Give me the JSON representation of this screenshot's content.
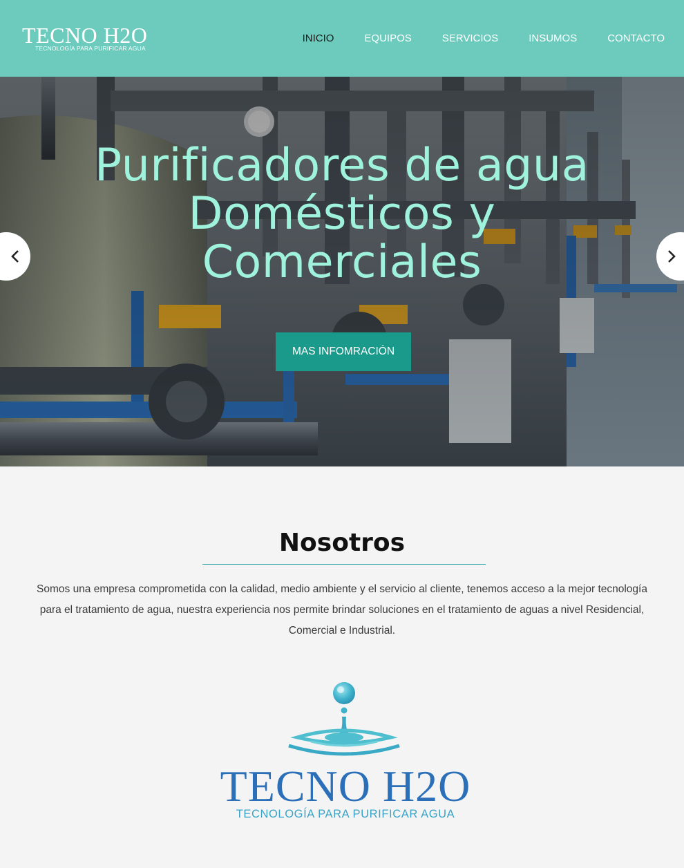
{
  "header": {
    "logo_title": "TECNO H2O",
    "logo_subtitle": "TECNOLOGÍA PARA PURIFICAR AGUA",
    "nav": [
      {
        "label": "INICIO",
        "active": true
      },
      {
        "label": "EQUIPOS",
        "active": false
      },
      {
        "label": "SERVICIOS",
        "active": false
      },
      {
        "label": "INSUMOS",
        "active": false
      },
      {
        "label": "CONTACTO",
        "active": false
      }
    ]
  },
  "hero": {
    "title_lines": [
      "Purificadores de agua",
      "Domésticos y",
      "Comerciales"
    ],
    "button_label": "MAS INFOMRACIÓN",
    "prev_icon": "chevron-left-icon",
    "next_icon": "chevron-right-icon"
  },
  "about": {
    "title": "Nosotros",
    "text": "Somos una empresa comprometida con la calidad, medio ambiente y el servicio al cliente, tenemos acceso a la mejor tecnología para el tratamiento de agua, nuestra experiencia nos permite brindar soluciones en el tratamiento de aguas a nivel Residencial, Comercial e Industrial."
  },
  "brand_logo": {
    "title": "TECNO H2O",
    "subtitle": "TECNOLOGÍA PARA PURIFICAR AGUA",
    "icon": "water-drop-icon"
  },
  "colors": {
    "header_bg": "#6ccbbd",
    "hero_title": "#9ff2dc",
    "button_bg": "#1a9a8a",
    "brand_blue": "#2a6fb8",
    "brand_light_blue": "#3aa4c8",
    "page_bg": "#f4f4f4"
  }
}
